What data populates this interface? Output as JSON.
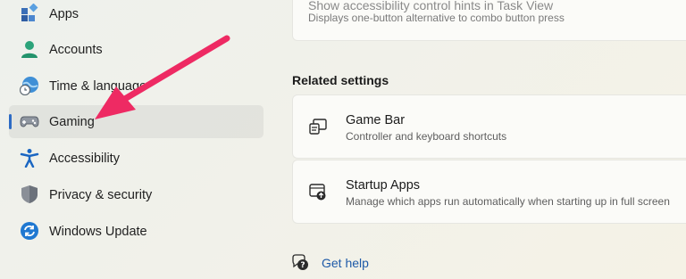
{
  "sidebar": {
    "items": [
      {
        "label": "Apps",
        "icon": "apps-icon"
      },
      {
        "label": "Accounts",
        "icon": "accounts-icon"
      },
      {
        "label": "Time & language",
        "icon": "time-language-icon"
      },
      {
        "label": "Gaming",
        "icon": "gamepad-icon",
        "selected": true
      },
      {
        "label": "Accessibility",
        "icon": "accessibility-icon"
      },
      {
        "label": "Privacy & security",
        "icon": "shield-icon"
      },
      {
        "label": "Windows Update",
        "icon": "windows-update-icon"
      }
    ]
  },
  "main": {
    "top_setting": {
      "title": "Show accessibility control hints in Task View",
      "description": "Displays one-button alternative to combo button press"
    },
    "related_settings": {
      "title": "Related settings",
      "items": [
        {
          "title": "Game Bar",
          "description": "Controller and keyboard shortcuts",
          "icon": "game-bar-icon"
        },
        {
          "title": "Startup Apps",
          "description": "Manage which apps run automatically when starting up in full screen",
          "icon": "startup-apps-icon"
        }
      ]
    },
    "help": {
      "label": "Get help",
      "icon": "help-icon"
    }
  },
  "annotation": {
    "color": "#ee2a63"
  },
  "colors": {
    "accent": "#2d6bc4",
    "link": "#1e5aa8"
  }
}
